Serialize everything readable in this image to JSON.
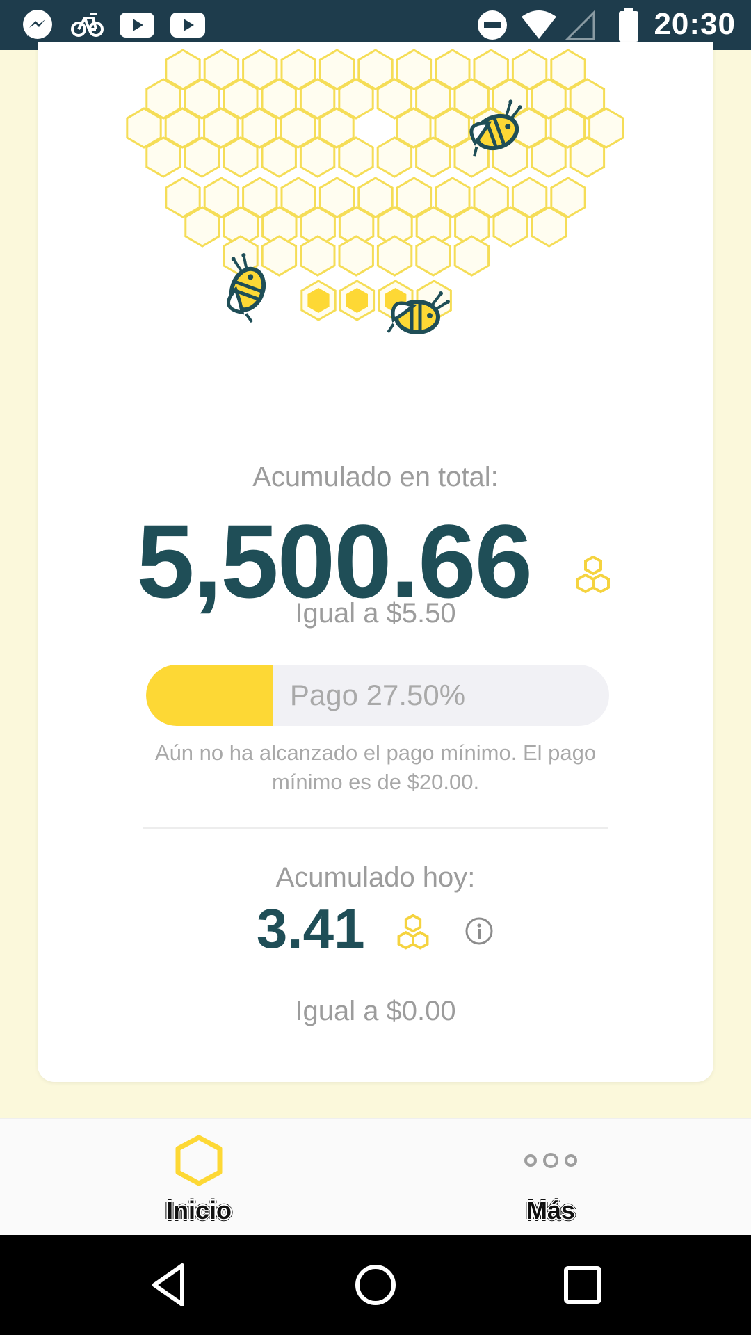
{
  "status_bar": {
    "time": "20:30",
    "icons_left": [
      "messenger-icon",
      "bike-app-icon",
      "youtube-icon",
      "youtube-icon"
    ],
    "icons_right": [
      "do-not-disturb-icon",
      "wifi-icon",
      "signal-icon",
      "battery-icon"
    ]
  },
  "colors": {
    "accent_yellow": "#FDD835",
    "dark_teal": "#1F4E57",
    "hex_outline": "#F5DD57",
    "background": "#FBF8DB"
  },
  "summary": {
    "total_label": "Acumulado en total:",
    "total_value": "5,500.66",
    "total_equivalent": "Igual a $5.50",
    "progress_label": "Pago 27.50%",
    "progress_fraction": 0.275,
    "min_payment_message": "Aún no ha alcanzado el pago mínimo. El pago mínimo es de $20.00.",
    "today_label": "Acumulado hoy:",
    "today_value": "3.41",
    "today_equivalent": "Igual a $0.00"
  },
  "bottom_nav": {
    "items": [
      {
        "label": "Inicio",
        "icon": "hexagon-icon",
        "active": true
      },
      {
        "label": "Más",
        "icon": "more-dots-icon",
        "active": false
      }
    ]
  },
  "system_nav": [
    "back-icon",
    "home-icon",
    "recents-icon"
  ]
}
